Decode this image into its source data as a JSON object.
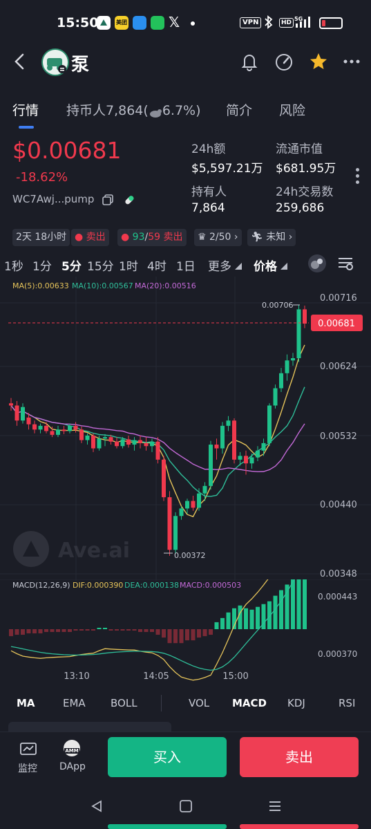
{
  "status_bar": {
    "time": "15:50",
    "vpn": "VPN",
    "hd": "HD",
    "network": "5G",
    "app_icons": [
      "ave-icon",
      "meituan-icon",
      "app-icon",
      "message-icon",
      "x-icon"
    ],
    "meituan_label": "美团"
  },
  "header": {
    "title": "泵"
  },
  "tabs": [
    {
      "label": "行情"
    },
    {
      "label": "持币人7,864("
    },
    {
      "label": "6.7%)"
    },
    {
      "label": "简介"
    },
    {
      "label": "风险"
    }
  ],
  "summary": {
    "price": "$0.00681",
    "change": "-18.62%",
    "address": "WC7Awj...pump",
    "stats": [
      {
        "label": "24h额",
        "value": "$5,597.21万"
      },
      {
        "label": "流通市值",
        "value": "$681.95万"
      },
      {
        "label": "持有人",
        "value": "7,864"
      },
      {
        "label": "24h交易数",
        "value": "259,686"
      }
    ]
  },
  "chips": {
    "age": "2天 18小时",
    "sell1": "卖出",
    "buys": "93",
    "slash": "/",
    "sells": "59",
    "sell2": "卖出",
    "rank": "2/50",
    "unknown": "未知"
  },
  "intervals": [
    {
      "label": "1秒"
    },
    {
      "label": "1分"
    },
    {
      "label": "5分"
    },
    {
      "label": "15分"
    },
    {
      "label": "1时"
    },
    {
      "label": "4时"
    },
    {
      "label": "1日"
    },
    {
      "label": "更多"
    },
    {
      "label": "价格"
    }
  ],
  "chart_data": [
    {
      "type": "candlestick",
      "title": "",
      "ma_legend": [
        {
          "name": "MA(5)",
          "value": "0.00633",
          "color": "#e6c45a"
        },
        {
          "name": "MA(10)",
          "value": "0.00567",
          "color": "#2fbf9a"
        },
        {
          "name": "MA(20)",
          "value": "0.00516",
          "color": "#c46ad8"
        }
      ],
      "y_ticks": [
        "0.00716",
        "0.00624",
        "0.00532",
        "0.00440",
        "0.00348"
      ],
      "ylim": [
        0.00348,
        0.00716
      ],
      "x_ticks": [
        "13:10",
        "14:05",
        "15:00"
      ],
      "current_price_label": "0.00681",
      "current_price": 0.00681,
      "high_label": "0.00706",
      "low_label": "0.00372",
      "watermark": "Ave.ai",
      "candles": [
        {
          "o": 0.00575,
          "h": 0.00582,
          "l": 0.00565,
          "c": 0.00572
        },
        {
          "o": 0.00572,
          "h": 0.00578,
          "l": 0.00545,
          "c": 0.00552
        },
        {
          "o": 0.00552,
          "h": 0.00575,
          "l": 0.00548,
          "c": 0.0057
        },
        {
          "o": 0.00556,
          "h": 0.00562,
          "l": 0.0054,
          "c": 0.00547
        },
        {
          "o": 0.00547,
          "h": 0.00552,
          "l": 0.00535,
          "c": 0.0054
        },
        {
          "o": 0.0054,
          "h": 0.00548,
          "l": 0.00535,
          "c": 0.00545
        },
        {
          "o": 0.00545,
          "h": 0.0055,
          "l": 0.00535,
          "c": 0.00538
        },
        {
          "o": 0.00538,
          "h": 0.00544,
          "l": 0.0053,
          "c": 0.00533
        },
        {
          "o": 0.00533,
          "h": 0.00545,
          "l": 0.0053,
          "c": 0.0054
        },
        {
          "o": 0.0054,
          "h": 0.00545,
          "l": 0.00534,
          "c": 0.00538
        },
        {
          "o": 0.00538,
          "h": 0.00548,
          "l": 0.00535,
          "c": 0.00545
        },
        {
          "o": 0.00545,
          "h": 0.0055,
          "l": 0.00536,
          "c": 0.0054
        },
        {
          "o": 0.0054,
          "h": 0.00544,
          "l": 0.00522,
          "c": 0.00526
        },
        {
          "o": 0.00526,
          "h": 0.00535,
          "l": 0.0052,
          "c": 0.00532
        },
        {
          "o": 0.00532,
          "h": 0.00535,
          "l": 0.0051,
          "c": 0.00515
        },
        {
          "o": 0.00515,
          "h": 0.00532,
          "l": 0.00512,
          "c": 0.00528
        },
        {
          "o": 0.00528,
          "h": 0.00534,
          "l": 0.00518,
          "c": 0.0053
        },
        {
          "o": 0.0053,
          "h": 0.00533,
          "l": 0.0052,
          "c": 0.00524
        },
        {
          "o": 0.00524,
          "h": 0.0053,
          "l": 0.00515,
          "c": 0.00518
        },
        {
          "o": 0.00518,
          "h": 0.0053,
          "l": 0.00515,
          "c": 0.00527
        },
        {
          "o": 0.00527,
          "h": 0.00532,
          "l": 0.00516,
          "c": 0.0052
        },
        {
          "o": 0.0052,
          "h": 0.0053,
          "l": 0.00512,
          "c": 0.00526
        },
        {
          "o": 0.00526,
          "h": 0.00532,
          "l": 0.00515,
          "c": 0.00522
        },
        {
          "o": 0.00522,
          "h": 0.0053,
          "l": 0.00512,
          "c": 0.00518
        },
        {
          "o": 0.00518,
          "h": 0.00528,
          "l": 0.0051,
          "c": 0.00524
        },
        {
          "o": 0.00524,
          "h": 0.0053,
          "l": 0.00495,
          "c": 0.005
        },
        {
          "o": 0.005,
          "h": 0.00505,
          "l": 0.00445,
          "c": 0.0045
        },
        {
          "o": 0.0045,
          "h": 0.00458,
          "l": 0.00372,
          "c": 0.0038
        },
        {
          "o": 0.0038,
          "h": 0.0043,
          "l": 0.00375,
          "c": 0.00425
        },
        {
          "o": 0.00425,
          "h": 0.00438,
          "l": 0.0042,
          "c": 0.00435
        },
        {
          "o": 0.00435,
          "h": 0.00448,
          "l": 0.00428,
          "c": 0.00445
        },
        {
          "o": 0.00445,
          "h": 0.00452,
          "l": 0.00432,
          "c": 0.00436
        },
        {
          "o": 0.00436,
          "h": 0.00462,
          "l": 0.00432,
          "c": 0.00455
        },
        {
          "o": 0.00455,
          "h": 0.0047,
          "l": 0.00445,
          "c": 0.00465
        },
        {
          "o": 0.00465,
          "h": 0.00525,
          "l": 0.0046,
          "c": 0.0052
        },
        {
          "o": 0.0052,
          "h": 0.00528,
          "l": 0.005,
          "c": 0.00515
        },
        {
          "o": 0.00515,
          "h": 0.0055,
          "l": 0.00508,
          "c": 0.00545
        },
        {
          "o": 0.00545,
          "h": 0.00558,
          "l": 0.00538,
          "c": 0.00552
        },
        {
          "o": 0.00552,
          "h": 0.00555,
          "l": 0.00495,
          "c": 0.005
        },
        {
          "o": 0.005,
          "h": 0.0051,
          "l": 0.00492,
          "c": 0.00505
        },
        {
          "o": 0.00505,
          "h": 0.00512,
          "l": 0.0048,
          "c": 0.00495
        },
        {
          "o": 0.00495,
          "h": 0.00508,
          "l": 0.00488,
          "c": 0.00503
        },
        {
          "o": 0.00503,
          "h": 0.00518,
          "l": 0.00498,
          "c": 0.00512
        },
        {
          "o": 0.00512,
          "h": 0.00528,
          "l": 0.00505,
          "c": 0.00522
        },
        {
          "o": 0.00522,
          "h": 0.00575,
          "l": 0.00518,
          "c": 0.00572
        },
        {
          "o": 0.00572,
          "h": 0.006,
          "l": 0.00568,
          "c": 0.00595
        },
        {
          "o": 0.00595,
          "h": 0.00622,
          "l": 0.0059,
          "c": 0.00615
        },
        {
          "o": 0.00615,
          "h": 0.0064,
          "l": 0.00605,
          "c": 0.00632
        },
        {
          "o": 0.00632,
          "h": 0.00642,
          "l": 0.00625,
          "c": 0.00635
        },
        {
          "o": 0.00635,
          "h": 0.00706,
          "l": 0.0063,
          "c": 0.007
        },
        {
          "o": 0.007,
          "h": 0.00705,
          "l": 0.00675,
          "c": 0.00681
        }
      ]
    },
    {
      "type": "bar",
      "title": "MACD(12,26,9)",
      "dif_label": "DIF:0.000390",
      "dea_label": "DEA:0.000138",
      "macd_label": "MACD:0.000503",
      "y_ticks": [
        "0.000443",
        "0.000370"
      ],
      "histogram": [
        -5e-05,
        -4e-05,
        -4e-05,
        -3e-05,
        -3e-05,
        -3e-05,
        -2e-05,
        -2e-05,
        -2e-05,
        -2e-05,
        -2e-05,
        -1e-05,
        -1e-05,
        -1e-05,
        -1e-05,
        1e-05,
        1e-05,
        -1e-05,
        -1e-05,
        -1e-05,
        -1e-05,
        -1e-05,
        -2e-05,
        -2e-05,
        -2e-05,
        -4e-05,
        -6e-05,
        -0.0001,
        -0.0001,
        -0.0001,
        -8e-05,
        -8e-05,
        -6e-05,
        -5e-05,
        -4e-05,
        5e-05,
        8e-05,
        0.00012,
        0.00015,
        0.00017,
        0.00015,
        0.00014,
        0.00016,
        0.00018,
        0.0002,
        0.00024,
        0.00028,
        0.00032,
        0.00038,
        0.00044,
        0.0005
      ]
    }
  ],
  "indicator_tabs": [
    "MA",
    "EMA",
    "BOLL",
    "VOL",
    "MACD",
    "KDJ",
    "RSI"
  ],
  "bottom": {
    "monitor_label": "监控",
    "dapp_label": "DApp",
    "amm_label": "AMM",
    "buy_label": "买入",
    "sell_label": "卖出"
  },
  "colors": {
    "up": "#1fc28b",
    "down": "#f0394d",
    "accent": "#3f7df0",
    "background": "#1b1d26"
  }
}
